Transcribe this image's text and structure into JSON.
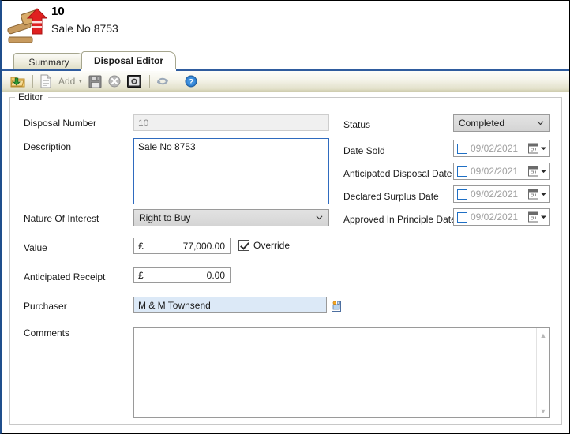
{
  "window": {
    "accent_border": "#1f4e8c",
    "tab_underline_color": "#2f5c9e"
  },
  "header": {
    "icon": "gavel-up-arrow-icon",
    "title": "10",
    "subtitle": "Sale No 8753"
  },
  "tabs": [
    {
      "label": "Summary",
      "active": false
    },
    {
      "label": "Disposal Editor",
      "active": true
    }
  ],
  "toolbar": {
    "buttons": [
      {
        "name": "open-folder-icon",
        "label": ""
      },
      {
        "name": "new-document-icon",
        "label": ""
      },
      {
        "name": "add-button",
        "label": "Add",
        "caret": "▼"
      },
      {
        "name": "save-icon",
        "label": ""
      },
      {
        "name": "delete-icon",
        "label": ""
      },
      {
        "name": "camera-icon",
        "label": ""
      },
      {
        "name": "refresh-icon",
        "label": ""
      },
      {
        "name": "help-icon",
        "label": ""
      }
    ],
    "add_label": "Add"
  },
  "groupbox": {
    "legend": "Editor"
  },
  "form": {
    "left": {
      "disposal_number": {
        "label": "Disposal Number",
        "value": "10",
        "disabled": true
      },
      "description": {
        "label": "Description",
        "value": "Sale No 8753"
      },
      "nature_of_interest": {
        "label": "Nature Of Interest",
        "value": "Right to Buy"
      },
      "value": {
        "label": "Value",
        "currency": "£",
        "amount": "77,000.00",
        "override_label": "Override",
        "override_checked": true
      },
      "anticipated_receipt": {
        "label": "Anticipated Receipt",
        "currency": "£",
        "amount": "0.00"
      },
      "purchaser": {
        "label": "Purchaser",
        "value": "M & M Townsend",
        "lookup_icon": "document-lookup-icon"
      },
      "comments": {
        "label": "Comments",
        "value": ""
      }
    },
    "right": {
      "status": {
        "label": "Status",
        "value": "Completed"
      },
      "date_sold": {
        "label": "Date Sold",
        "value": "09/02/2021",
        "checked": false
      },
      "anticipated_disposal_date": {
        "label": "Anticipated Disposal Date",
        "value": "09/02/2021",
        "checked": false
      },
      "declared_surplus_date": {
        "label": "Declared Surplus Date",
        "value": "09/02/2021",
        "checked": false
      },
      "approved_in_principle_date": {
        "label": "Approved In Principle Date",
        "value": "09/02/2021",
        "checked": false
      }
    }
  },
  "scrollbar": {
    "up_arrow": "▲",
    "down_arrow": "▼"
  }
}
